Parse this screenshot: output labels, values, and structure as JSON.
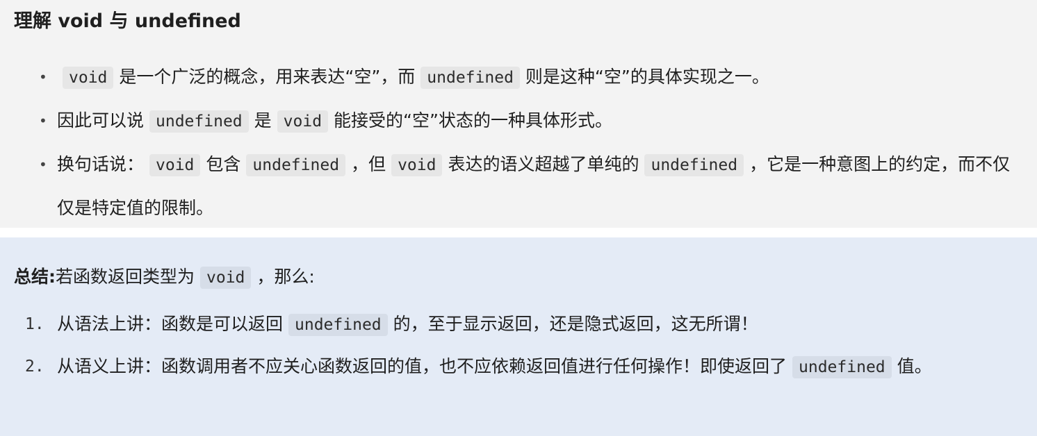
{
  "section1": {
    "title": "理解 void 与 undefined",
    "bullets": [
      {
        "parts": [
          {
            "code": "void"
          },
          {
            "text": "是一个广泛的概念，用来表达“空”，而"
          },
          {
            "code": "undefined"
          },
          {
            "text": "则是这种“空”的具体实现之一。"
          }
        ]
      },
      {
        "parts": [
          {
            "text": "因此可以说"
          },
          {
            "code": "undefined"
          },
          {
            "text": "是"
          },
          {
            "code": "void"
          },
          {
            "text": "能接受的“空”状态的一种具体形式。"
          }
        ]
      },
      {
        "parts": [
          {
            "text": "换句话说："
          },
          {
            "code": "void"
          },
          {
            "text": "包含"
          },
          {
            "code": "undefined"
          },
          {
            "text": "，但"
          },
          {
            "code": "void"
          },
          {
            "text": "表达的语义超越了单纯的"
          },
          {
            "code": "undefined"
          },
          {
            "text": "，它是一种意图上的约定，而不仅仅是特定值的限制。"
          }
        ]
      }
    ]
  },
  "section2": {
    "summary_label": "总结:",
    "summary_prefix": "若函数返回类型为",
    "summary_code": "void",
    "summary_suffix": "，那么:",
    "items": [
      {
        "number": "1.",
        "parts": [
          {
            "text": "从语法上讲：函数是可以返回"
          },
          {
            "code": "undefined"
          },
          {
            "text": "的，至于显示返回，还是隐式返回，这无所谓！"
          }
        ]
      },
      {
        "number": "2.",
        "parts": [
          {
            "text": "从语义上讲：函数调用者不应关心函数返回的值，也不应依赖返回值进行任何操作！即使返回了"
          },
          {
            "code": "undefined"
          },
          {
            "text": "值。"
          }
        ]
      }
    ]
  },
  "colors": {
    "top_background": "#f3f3f3",
    "bottom_background": "#e4ebf6",
    "code_background": "#e6e6e6"
  }
}
